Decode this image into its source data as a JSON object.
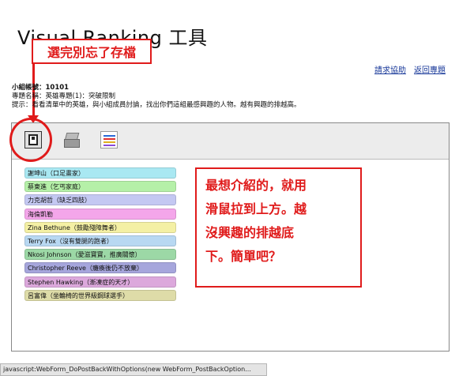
{
  "header": {
    "title": "Visual Ranking 工具",
    "callout_save": "選完別忘了存檔"
  },
  "nav_links": {
    "help": "請求協助",
    "back": "返回專題"
  },
  "info": {
    "group_id": "小組帳號：10101",
    "topic": "專題名稱：英雄專題(1)：突破限制",
    "hint": "提示：看看清單中的英雄，與小組成員討論，找出你們這組最感興趣的人物。越有興趣的排越高。"
  },
  "toolbar": {
    "icons": [
      "floppy-disk-icon",
      "printer-icon",
      "ranking-chart-icon"
    ]
  },
  "ranking_items": [
    {
      "label": "謝坤山（口足畫家）",
      "color": "#a9e8f2"
    },
    {
      "label": "蔡東進（乞丐家庭）",
      "color": "#b5f0a8"
    },
    {
      "label": "力克胡哲（缺乏四肢）",
      "color": "#c4c8f2"
    },
    {
      "label": "海倫凱勒",
      "color": "#f4a6ea"
    },
    {
      "label": "Zina Bethune（鼓勵殘障舞者）",
      "color": "#f4f0a4"
    },
    {
      "label": "Terry Fox（沒有雙腿的跑者）",
      "color": "#b8d8f2"
    },
    {
      "label": "Nkosi Johnson（愛滋寶寶，推廣關懷）",
      "color": "#9cd8a6"
    },
    {
      "label": "Christopher Reeve（癱瘓後仍不放棄）",
      "color": "#a6a6dc"
    },
    {
      "label": "Stephen Hawking（漸凍症的天才）",
      "color": "#dca8dc"
    },
    {
      "label": "呂富偉（坐輪椅的世界級鋼球選手）",
      "color": "#dedca8"
    }
  ],
  "callout_main": {
    "lines": [
      "最想介紹的，就用",
      "滑鼠拉到上方。越",
      "沒興趣的排越底",
      "下。簡單吧？"
    ]
  },
  "status_bar": {
    "text": "javascript:WebForm_DoPostBackWithOptions(new WebForm_PostBackOption..."
  },
  "colors": {
    "accent_red": "#e01b1b",
    "link_blue": "#1a3a9a"
  }
}
